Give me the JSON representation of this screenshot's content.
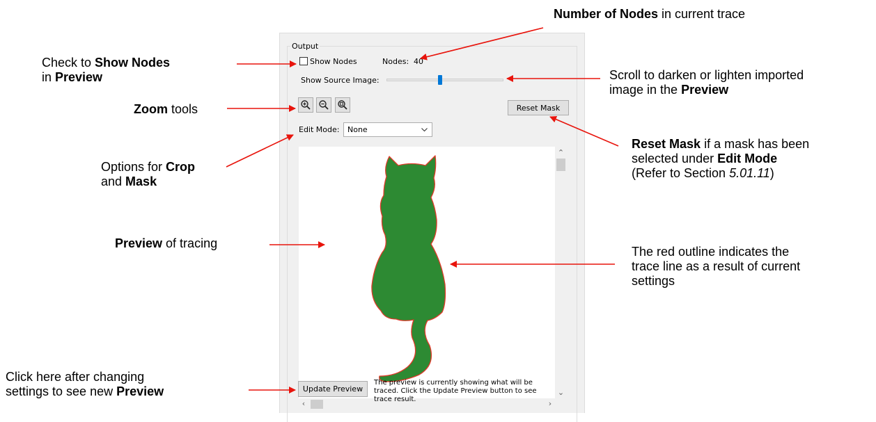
{
  "annotations": {
    "show_nodes": {
      "pre": "Check to ",
      "b1": "Show Nodes",
      "mid": "in ",
      "b2": "Preview"
    },
    "zoom": {
      "b": "Zoom",
      "rest": " tools"
    },
    "crop_mask": {
      "pre": "Options for ",
      "b1": "Crop",
      "mid": "and ",
      "b2": "Mask"
    },
    "preview": {
      "b": "Preview",
      "rest": " of tracing"
    },
    "update": {
      "line1": "Click here after changing",
      "pre": "settings to see new ",
      "b": "Preview"
    },
    "nodes_count": {
      "b": "Number of Nodes",
      "rest": " in current trace"
    },
    "source_image": {
      "line1": "Scroll to darken or lighten imported",
      "pre": "image in the ",
      "b": "Preview"
    },
    "reset_mask": {
      "b1": "Reset Mask",
      "r1": " if a mask has been",
      "pre2": "selected under ",
      "b2": "Edit Mode",
      "pre3": "(Refer to Section ",
      "i3": "5.01.11",
      "post3": ")"
    },
    "red_outline": {
      "line1": "The red outline indicates the",
      "line2": "trace line as a result of current",
      "line3": "settings"
    }
  },
  "panel": {
    "group_title": "Output",
    "show_nodes_label": "Show Nodes",
    "show_nodes_checked": false,
    "nodes_label": "Nodes:",
    "nodes_value": "40",
    "source_image_label": "Show Source Image:",
    "source_image_level": 0.46,
    "zoom_icons": [
      "zoom-in-icon",
      "zoom-out-icon",
      "zoom-fit-icon"
    ],
    "reset_mask_label": "Reset Mask",
    "edit_mode_label": "Edit Mode:",
    "edit_mode_value": "None",
    "update_preview_label": "Update Preview",
    "status_text": "The preview is currently showing what will be traced. Click the Update Preview button to see trace result.",
    "colors": {
      "cat_fill": "#2d8a33",
      "cat_outline": "#e03a2a",
      "arrows": "#e8140c",
      "slider_thumb": "#0078d7"
    }
  }
}
